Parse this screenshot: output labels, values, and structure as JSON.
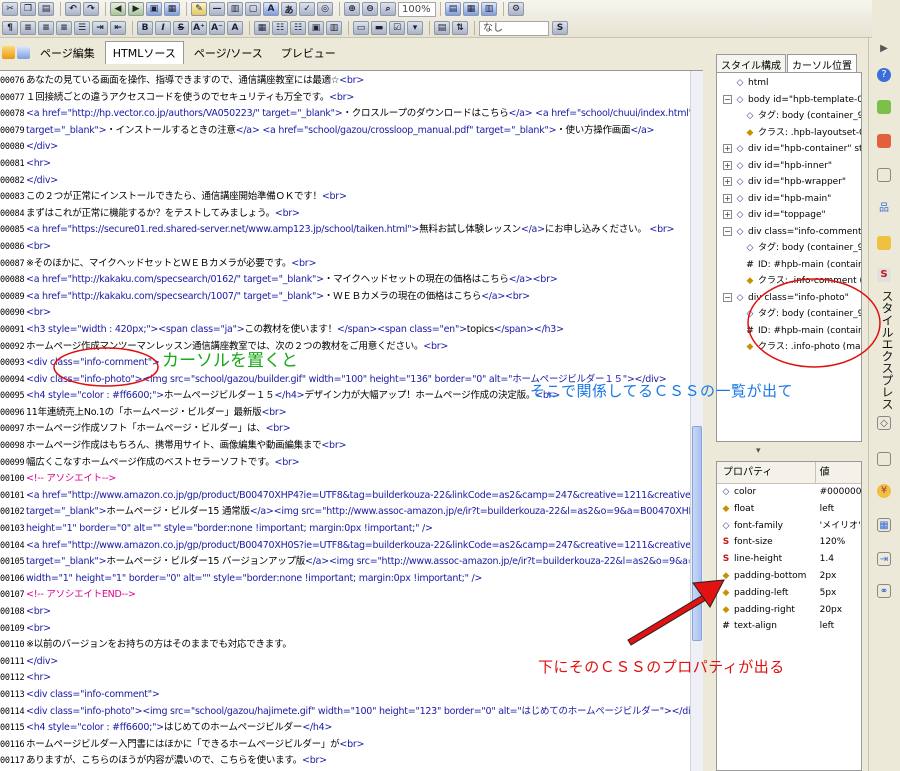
{
  "toolbar": {
    "zoom_value": "100%",
    "font_select_value": "なし",
    "bold_label": "B",
    "italic_label": "I",
    "strike_label": "S",
    "link_label": "A"
  },
  "tabs": [
    {
      "label": "ページ編集"
    },
    {
      "label": "HTMLソース"
    },
    {
      "label": "ページ/ソース"
    },
    {
      "label": "プレビュー"
    }
  ],
  "code_lines": [
    {
      "num": "00076",
      "parts": [
        {
          "t": "あなたの見ている画面を操作、指導できますので、通信講座教室には最適☆",
          "c": "tx"
        },
        {
          "t": "<br>",
          "c": "tg"
        }
      ]
    },
    {
      "num": "00077",
      "parts": [
        {
          "t": "１回接続ごとの違うアクセスコードを使うのでセキュリティも万全です。",
          "c": "tx"
        },
        {
          "t": "<br>",
          "c": "tg"
        }
      ]
    },
    {
      "num": "00078",
      "parts": [
        {
          "t": "<a href=\"http://hp.vector.co.jp/authors/VA050223/\" target=\"_blank\">",
          "c": "tg"
        },
        {
          "t": "・クロスループのダウンロードはこちら",
          "c": "tx"
        },
        {
          "t": "</a>   <a href=\"school/chuui/index.html\"",
          "c": "tg"
        }
      ]
    },
    {
      "num": "00079",
      "parts": [
        {
          "t": "target=\"_blank\">",
          "c": "tg"
        },
        {
          "t": "・インストールするときの注意",
          "c": "tx"
        },
        {
          "t": "</a>   <a href=\"school/gazou/crossloop_manual.pdf\" target=\"_blank\">",
          "c": "tg"
        },
        {
          "t": "・使い方操作画面",
          "c": "tx"
        },
        {
          "t": "</a>",
          "c": "tg"
        }
      ]
    },
    {
      "num": "00080",
      "parts": [
        {
          "t": "</div>",
          "c": "tg"
        }
      ]
    },
    {
      "num": "00081",
      "parts": [
        {
          "t": "<hr>",
          "c": "tg"
        }
      ]
    },
    {
      "num": "00082",
      "parts": [
        {
          "t": "</div>",
          "c": "tg"
        }
      ]
    },
    {
      "num": "00083",
      "parts": [
        {
          "t": "この２つが正常にインストールできたら、通信講座開始準備ＯＫです！",
          "c": "tx"
        },
        {
          "t": "<br>",
          "c": "tg"
        }
      ]
    },
    {
      "num": "00084",
      "parts": [
        {
          "t": "まずはこれが正常に機能するか？をテストしてみましょう。",
          "c": "tx"
        },
        {
          "t": "<br>",
          "c": "tg"
        }
      ]
    },
    {
      "num": "00085",
      "parts": [
        {
          "t": "<a href=\"https://secure01.red.shared-server.net/www.amp123.jp/school/taiken.html\">",
          "c": "tg"
        },
        {
          "t": "無料お試し体験レッスン",
          "c": "tx"
        },
        {
          "t": "</a>",
          "c": "tg"
        },
        {
          "t": "にお申し込みください。 ",
          "c": "tx"
        },
        {
          "t": "<br>",
          "c": "tg"
        }
      ]
    },
    {
      "num": "00086",
      "parts": [
        {
          "t": "<br>",
          "c": "tg"
        }
      ]
    },
    {
      "num": "00087",
      "parts": [
        {
          "t": "※そのほかに、マイクヘッドセットとＷＥＢカメラが必要です。",
          "c": "tx"
        },
        {
          "t": "<br>",
          "c": "tg"
        }
      ]
    },
    {
      "num": "00088",
      "parts": [
        {
          "t": "<a href=\"http://kakaku.com/specsearch/0162/\" target=\"_blank\">",
          "c": "tg"
        },
        {
          "t": "・マイクヘッドセットの現在の価格はこちら",
          "c": "tx"
        },
        {
          "t": "</a><br>",
          "c": "tg"
        }
      ]
    },
    {
      "num": "00089",
      "parts": [
        {
          "t": "<a href=\"http://kakaku.com/specsearch/1007/\" target=\"_blank\">",
          "c": "tg"
        },
        {
          "t": "・ＷＥＢカメラの現在の価格はこちら",
          "c": "tx"
        },
        {
          "t": "</a><br>",
          "c": "tg"
        }
      ]
    },
    {
      "num": "00090",
      "parts": [
        {
          "t": "<br>",
          "c": "tg"
        }
      ]
    },
    {
      "num": "00091",
      "parts": [
        {
          "t": "<h3 style=\"width : 420px;\"><span class=\"ja\">",
          "c": "tg"
        },
        {
          "t": "この教材を使います！",
          "c": "tx"
        },
        {
          "t": "</span><span class=\"en\">",
          "c": "tg"
        },
        {
          "t": "topics",
          "c": "tx"
        },
        {
          "t": "</span></h3>",
          "c": "tg"
        }
      ]
    },
    {
      "num": "00092",
      "parts": [
        {
          "t": "ホームページ作成マンツーマンレッスン通信講座教室では、次の２つの教材をご用意ください。",
          "c": "tx"
        },
        {
          "t": "<br>",
          "c": "tg"
        }
      ]
    },
    {
      "num": "00093",
      "parts": [
        {
          "t": "<div class=\"info-comment\">",
          "c": "tg"
        }
      ]
    },
    {
      "num": "00094",
      "parts": [
        {
          "t": "<div class=\"info-photo\"><img src=\"school/gazou/builder.gif\" width=\"100\" height=\"136\" border=\"0\" alt=\"ホームページビルダー１５\"></div>",
          "c": "tg"
        }
      ]
    },
    {
      "num": "00095",
      "parts": [
        {
          "t": "<h4 style=\"color : #ff6600;\">",
          "c": "tg"
        },
        {
          "t": "ホームページビルダー１５",
          "c": "tx"
        },
        {
          "t": "</h4>",
          "c": "tg"
        },
        {
          "t": "デザイン力が大幅アップ！ホームページ作成の決定版。",
          "c": "tx"
        },
        {
          "t": "<br>",
          "c": "tg"
        }
      ]
    },
    {
      "num": "00096",
      "parts": [
        {
          "t": "11年連続売上No.1の「ホームページ・ビルダー」最新版",
          "c": "tx"
        },
        {
          "t": "<br>",
          "c": "tg"
        }
      ]
    },
    {
      "num": "00097",
      "parts": [
        {
          "t": "ホームページ作成ソフト「ホームページ・ビルダー」は、",
          "c": "tx"
        },
        {
          "t": "<br>",
          "c": "tg"
        }
      ]
    },
    {
      "num": "00098",
      "parts": [
        {
          "t": "ホームページ作成はもちろん、携帯用サイト、画像編集や動画編集まで",
          "c": "tx"
        },
        {
          "t": "<br>",
          "c": "tg"
        }
      ]
    },
    {
      "num": "00099",
      "parts": [
        {
          "t": "幅広くこなすホームページ作成のベストセラーソフトです。",
          "c": "tx"
        },
        {
          "t": "<br>",
          "c": "tg"
        }
      ]
    },
    {
      "num": "00100",
      "parts": [
        {
          "t": "<!-- アソシエイト-->",
          "c": "cm"
        }
      ]
    },
    {
      "num": "00101",
      "parts": [
        {
          "t": "<a href=\"http://www.amazon.co.jp/gp/product/B00470XHP4?ie=UTF8&tag=builderkouza-22&linkCode=as2&camp=247&creative=1211&creativeASIN=B00470XHP4\"",
          "c": "tg"
        }
      ]
    },
    {
      "num": "00102",
      "parts": [
        {
          "t": "target=\"_blank\">",
          "c": "tg"
        },
        {
          "t": "ホームページ・ビルダー15 通常版",
          "c": "tx"
        },
        {
          "t": "</a><img src=\"http://www.assoc-amazon.jp/e/ir?t=builderkouza-22&l=as2&o=9&a=B00470XHP4\" width=\"1\"",
          "c": "tg"
        }
      ]
    },
    {
      "num": "00103",
      "parts": [
        {
          "t": "height=\"1\" border=\"0\" alt=\"\" style=\"border:none !important; margin:0px !important;\" />",
          "c": "tg"
        }
      ]
    },
    {
      "num": "00104",
      "parts": [
        {
          "t": "<a href=\"http://www.amazon.co.jp/gp/product/B00470XH0S?ie=UTF8&tag=builderkouza-22&linkCode=as2&camp=247&creative=1211&creativeASIN=B00470XH0S\"",
          "c": "tg"
        }
      ]
    },
    {
      "num": "00105",
      "parts": [
        {
          "t": "target=\"_blank\">",
          "c": "tg"
        },
        {
          "t": "ホームページ・ビルダー15 バージョンアップ版",
          "c": "tx"
        },
        {
          "t": "</a><img src=\"http://www.assoc-amazon.jp/e/ir?t=builderkouza-22&l=as2&o=9&a=B00470XH0S\"",
          "c": "tg"
        }
      ]
    },
    {
      "num": "00106",
      "parts": [
        {
          "t": "width=\"1\" height=\"1\" border=\"0\" alt=\"\" style=\"border:none !important; margin:0px !important;\" />",
          "c": "tg"
        }
      ]
    },
    {
      "num": "00107",
      "parts": [
        {
          "t": "<!-- アソシエイトEND-->",
          "c": "cm"
        }
      ]
    },
    {
      "num": "00108",
      "parts": [
        {
          "t": "<br>",
          "c": "tg"
        }
      ]
    },
    {
      "num": "00109",
      "parts": [
        {
          "t": "<br>",
          "c": "tg"
        }
      ]
    },
    {
      "num": "00110",
      "parts": [
        {
          "t": "※以前のバージョンをお持ちの方はそのままでも対応できます。",
          "c": "tx"
        }
      ]
    },
    {
      "num": "00111",
      "parts": [
        {
          "t": "</div>",
          "c": "tg"
        }
      ]
    },
    {
      "num": "00112",
      "parts": [
        {
          "t": "<hr>",
          "c": "tg"
        }
      ]
    },
    {
      "num": "00113",
      "parts": [
        {
          "t": "<div class=\"info-comment\">",
          "c": "tg"
        }
      ]
    },
    {
      "num": "00114",
      "parts": [
        {
          "t": "<div class=\"info-photo\"><img src=\"school/gazou/hajimete.gif\" width=\"100\" height=\"123\" border=\"0\" alt=\"はじめてのホームページビルダー\"></div>",
          "c": "tg"
        }
      ]
    },
    {
      "num": "00115",
      "parts": [
        {
          "t": "<h4 style=\"color : #ff6600;\">",
          "c": "tg"
        },
        {
          "t": "はじめてのホームページビルダー",
          "c": "tx"
        },
        {
          "t": "</h4>",
          "c": "tg"
        }
      ]
    },
    {
      "num": "00116",
      "parts": [
        {
          "t": "ホームページビルダー入門書にはほかに「できるホームページビルダー」が",
          "c": "tx"
        },
        {
          "t": "<br>",
          "c": "tg"
        }
      ]
    },
    {
      "num": "00117",
      "parts": [
        {
          "t": "ありますが、こちらのほうが内容が濃いので、こちらを使います。",
          "c": "tx"
        },
        {
          "t": "<br>",
          "c": "tg"
        }
      ]
    },
    {
      "num": "00118",
      "parts": [
        {
          "t": "<!-- アソシエイト-->",
          "c": "cm"
        }
      ]
    },
    {
      "num": "00119",
      "parts": [
        {
          "t": "<a href=\"http://www.amazon.co.jp/gp/product/4798028983?ie=UTF8&tag=builderkouza-22&linkCode=as2&camp=247&creative=1211&creativeASIN=4798028983\"",
          "c": "tg"
        }
      ]
    }
  ],
  "right_panel": {
    "tabs": [
      {
        "label": "スタイル構成"
      },
      {
        "label": "カーソル位置"
      }
    ],
    "dom_tree": [
      {
        "exp": "",
        "icon": "◇",
        "kind": "tag",
        "indent": 0,
        "label": "html"
      },
      {
        "exp": "−",
        "icon": "◇",
        "kind": "tag",
        "indent": 0,
        "label": "body id=\"hpb-template-09-0"
      },
      {
        "exp": "",
        "icon": "◇",
        "kind": "tag",
        "indent": 1,
        "label": "タグ: body (container_9A_2"
      },
      {
        "exp": "",
        "icon": "◆",
        "kind": "cls",
        "indent": 1,
        "label": "クラス: .hpb-layoutset-01 ("
      },
      {
        "exp": "+",
        "icon": "◇",
        "kind": "tag",
        "indent": 0,
        "label": "div id=\"hpb-container\" styles"
      },
      {
        "exp": "+",
        "icon": "◇",
        "kind": "tag",
        "indent": 0,
        "label": "div id=\"hpb-inner\""
      },
      {
        "exp": "+",
        "icon": "◇",
        "kind": "tag",
        "indent": 0,
        "label": "div id=\"hpb-wrapper\""
      },
      {
        "exp": "+",
        "icon": "◇",
        "kind": "tag",
        "indent": 0,
        "label": "div id=\"hpb-main\""
      },
      {
        "exp": "+",
        "icon": "◇",
        "kind": "tag",
        "indent": 0,
        "label": "div id=\"toppage\""
      },
      {
        "exp": "−",
        "icon": "◇",
        "kind": "tag",
        "indent": 0,
        "label": "div class=\"info-comment\""
      },
      {
        "exp": "",
        "icon": "◇",
        "kind": "tag",
        "indent": 1,
        "label": "タグ: body (container_9A_2"
      },
      {
        "exp": "",
        "icon": "#",
        "kind": "hash",
        "indent": 1,
        "label": "ID: #hpb-main (container_"
      },
      {
        "exp": "",
        "icon": "◆",
        "kind": "cls",
        "indent": 1,
        "label": "クラス: .info-comment (mai"
      },
      {
        "exp": "−",
        "icon": "◇",
        "kind": "tag",
        "indent": 0,
        "label": "div class=\"info-photo\""
      },
      {
        "exp": "",
        "icon": "◇",
        "kind": "tag",
        "indent": 1,
        "label": "タグ: body (container_9A_2"
      },
      {
        "exp": "",
        "icon": "#",
        "kind": "hash",
        "indent": 1,
        "label": "ID: #hpb-main (container_"
      },
      {
        "exp": "",
        "icon": "◆",
        "kind": "cls",
        "indent": 1,
        "label": "クラス: .info-photo (main_9"
      }
    ],
    "props_header": {
      "name": "プロパティ",
      "value": "値"
    },
    "properties": [
      {
        "icon": "◇",
        "kind": "d",
        "name": "color",
        "value": "#000000"
      },
      {
        "icon": "◆",
        "kind": "c",
        "name": "float",
        "value": "left"
      },
      {
        "icon": "◇",
        "kind": "d",
        "name": "font-family",
        "value": "'メイリオ',Me"
      },
      {
        "icon": "S",
        "kind": "s",
        "name": "font-size",
        "value": "120%"
      },
      {
        "icon": "S",
        "kind": "s",
        "name": "line-height",
        "value": "1.4"
      },
      {
        "icon": "◆",
        "kind": "c",
        "name": "padding-bottom",
        "value": "2px"
      },
      {
        "icon": "◆",
        "kind": "c",
        "name": "padding-left",
        "value": "5px"
      },
      {
        "icon": "◆",
        "kind": "c",
        "name": "padding-right",
        "value": "20px"
      },
      {
        "icon": "#",
        "kind": "h",
        "name": "text-align",
        "value": "left"
      }
    ]
  },
  "side_panel_label": "スタイルエクスプレス",
  "annotations": {
    "cursor_note": "カーソルを置くと",
    "css_list_note": "そこで関係してるＣＳＳの一覧が出て",
    "css_prop_note": "下にそのＣＳＳのプロパティが出る"
  },
  "colors": {
    "tag": "#1a1aa6",
    "comment": "#e00090",
    "circle": "#e01010",
    "cursor_note": "#18a818",
    "css_list_note": "#1a78e6",
    "css_prop_note": "#e01010"
  }
}
